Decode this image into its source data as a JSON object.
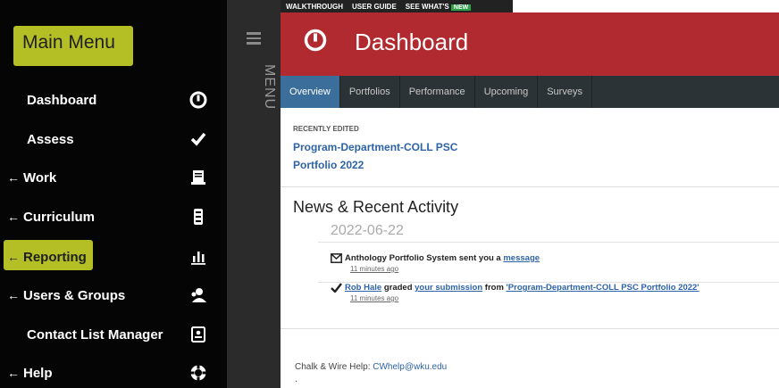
{
  "sidebar": {
    "title": "Main Menu",
    "items": [
      {
        "label": "Dashboard",
        "arrow": "",
        "icon": "dashboard-icon"
      },
      {
        "label": "Assess",
        "arrow": "",
        "icon": "checkmark-icon"
      },
      {
        "label": "Work",
        "arrow": "←",
        "icon": "work-icon"
      },
      {
        "label": "Curriculum",
        "arrow": "←",
        "icon": "curriculum-icon"
      },
      {
        "label": "Reporting",
        "arrow": "←",
        "icon": "bar-chart-icon"
      },
      {
        "label": "Users & Groups",
        "arrow": "←",
        "icon": "users-icon"
      },
      {
        "label": "Contact List Manager",
        "arrow": "",
        "icon": "contact-list-icon"
      },
      {
        "label": "Help",
        "arrow": "←",
        "icon": "help-icon"
      }
    ]
  },
  "menu_strip": {
    "label": "MENU"
  },
  "top_links": {
    "walkthrough": "WALKTHROUGH",
    "user_guide": "USER GUIDE",
    "whats_new": "SEE WHAT'S",
    "new_badge": "NEW"
  },
  "header": {
    "title": "Dashboard"
  },
  "tabs": [
    "Overview",
    "Portfolios",
    "Performance",
    "Upcoming",
    "Surveys"
  ],
  "recently_edited": {
    "label": "RECENTLY EDITED",
    "line1": "Program-Department-COLL PSC",
    "line2": "Portfolio 2022"
  },
  "news": {
    "title": "News & Recent Activity",
    "date": "2022-06-22",
    "activities": [
      {
        "actor": "Anthology Portfolio System",
        "verb": " sent you a ",
        "link": "message",
        "time": "11 minutes ago"
      },
      {
        "actor_link": "Rob Hale",
        "verb": " graded ",
        "link": "your submission",
        "from": " from ",
        "target_link": "'Program-Department-COLL PSC Portfolio 2022'",
        "time": "11 minutes ago"
      }
    ]
  },
  "footer": {
    "help_label": "Chalk & Wire Help: ",
    "help_email": "CWhelp@wku.edu",
    "dot": "."
  },
  "colors": {
    "header_red": "#b12a2f",
    "highlight": "#d4e02b",
    "tab_active": "#3b6e9b",
    "link": "#2d63a7"
  }
}
